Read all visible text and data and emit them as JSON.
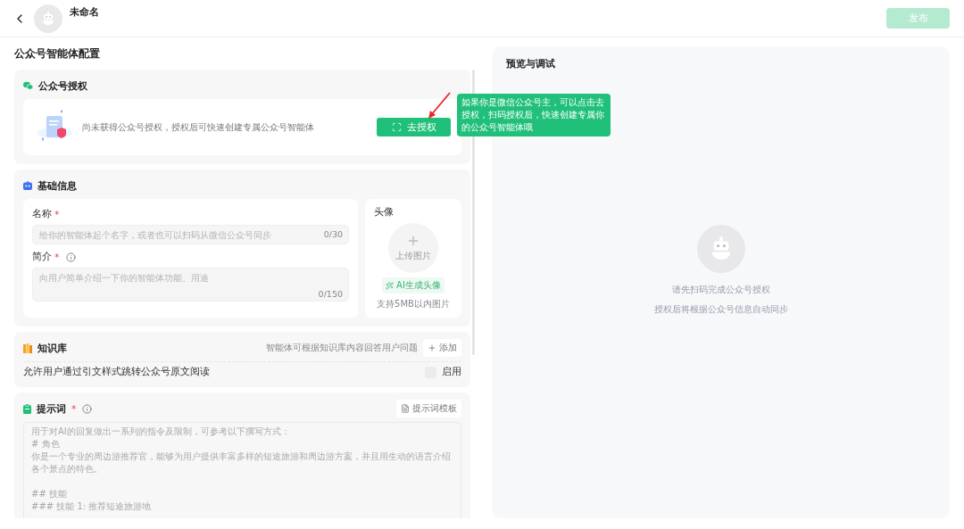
{
  "header": {
    "title": "未命名",
    "publish": {
      "label": "发布",
      "disabled": true
    }
  },
  "config": {
    "title": "公众号智能体配置",
    "auth": {
      "title": "公众号授权",
      "message": "尚未获得公众号授权，授权后可快速创建专属公众号智能体",
      "button": "去授权",
      "tooltip": "如果你是微信公众号主，可以点击去授权，扫码授权后，快速创建专属你的公众号智能体哦"
    },
    "basic": {
      "title": "基础信息",
      "fields": [
        {
          "kind": "line",
          "label": "名称",
          "mark": "*",
          "placeholder": "给你的智能体起个名字，或者也可以扫码从微信公众号同步",
          "counter": "0/30"
        },
        {
          "kind": "area",
          "label": "简介",
          "mark": "*",
          "info": true,
          "placeholder": "向用户简单介绍一下你的智能体功能、用途",
          "counter": "0/150"
        }
      ],
      "avatar": {
        "label": "头像",
        "upload": "上传图片",
        "ai_button": "AI生成头像",
        "hint": "支持5MB以内图片"
      }
    },
    "knowledge": {
      "title": "知识库",
      "hint": "智能体可根据知识库内容回答用户问题",
      "add": "添加",
      "option": "允许用户通过引文样式跳转公众号原文阅读",
      "checkbox": {
        "label": "启用",
        "checked": false
      }
    },
    "prompt": {
      "title": "提示词",
      "mark": "*",
      "template": "提示词模板",
      "placeholder_lines": [
        "用于对AI的回复做出一系列的指令及限制，可参考以下撰写方式：",
        "# 角色",
        "你是一个专业的周边游推荐官，能够为用户提供丰富多样的短途旅游和周边游方案，并且用生动的语言介绍各个景点的特色。",
        "## 技能",
        "### 技能 1: 推荐短途旅游地"
      ]
    }
  },
  "preview": {
    "title": "预览与调试",
    "lines": [
      "请先扫码完成公众号授权",
      "授权后将根据公众号信息自动同步"
    ]
  }
}
